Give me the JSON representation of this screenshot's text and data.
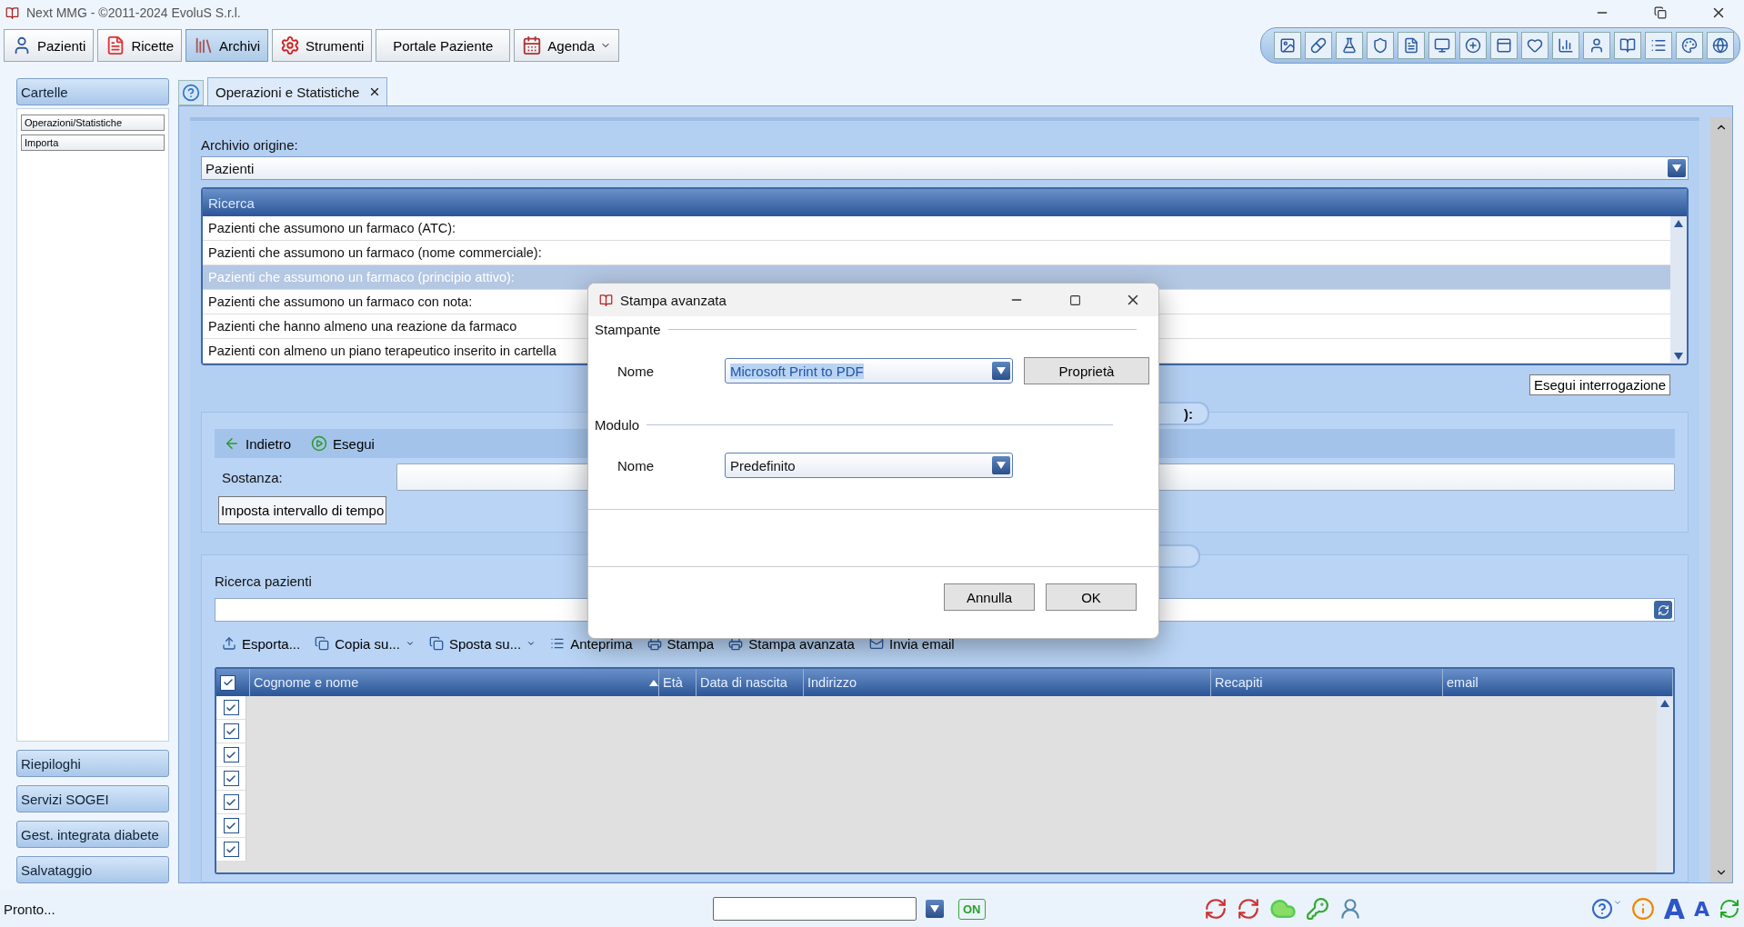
{
  "window": {
    "title": "Next MMG - ©2011-2024 EvoluS S.r.l."
  },
  "main_toolbar": [
    {
      "label": "Pazienti",
      "kind": "plain",
      "selected": false
    },
    {
      "label": "Ricette",
      "kind": "plain",
      "selected": false
    },
    {
      "label": "Archivi",
      "kind": "plain",
      "selected": true
    },
    {
      "label": "Strumenti",
      "kind": "plain",
      "selected": false
    },
    {
      "label": "Portale Paziente",
      "kind": "plain",
      "selected": false
    },
    {
      "label": "Agenda",
      "kind": "dropdown",
      "selected": false
    }
  ],
  "sidebar": {
    "open_section": {
      "title": "Cartelle",
      "items": [
        {
          "label": "Operazioni/Statistiche"
        },
        {
          "label": "Importa"
        }
      ]
    },
    "sections": [
      "Riepiloghi",
      "Servizi SOGEI",
      "Gest. integrata diabete",
      "Salvataggio"
    ]
  },
  "tab": {
    "label": "Operazioni e Statistiche"
  },
  "archive": {
    "label": "Archivio origine:",
    "value": "Pazienti"
  },
  "search_list": {
    "header": "Ricerca",
    "items": [
      {
        "label": "Pazienti che assumono un farmaco (ATC):",
        "selected": false
      },
      {
        "label": "Pazienti che assumono un farmaco (nome commerciale):",
        "selected": false
      },
      {
        "label": "Pazienti che assumono un farmaco (principio attivo):",
        "selected": true
      },
      {
        "label": "Pazienti che assumono un farmaco con nota:",
        "selected": false
      },
      {
        "label": "Pazienti che hanno almeno una reazione da farmaco",
        "selected": false
      },
      {
        "label": "Pazienti con almeno un piano terapeutico inserito in cartella",
        "selected": false
      }
    ]
  },
  "run_query_button": "Esegui interrogazione",
  "criteria": {
    "group_title": "):",
    "back": "Indietro",
    "run": "Esegui",
    "field_label": "Sostanza:",
    "time_button": "Imposta intervallo di tempo"
  },
  "patients": {
    "label": "Ricerca pazienti",
    "actions": [
      {
        "label": "Esporta...",
        "dropdown": false
      },
      {
        "label": "Copia su...",
        "dropdown": true
      },
      {
        "label": "Sposta su...",
        "dropdown": true
      },
      {
        "label": "Anteprima",
        "dropdown": false
      },
      {
        "label": "Stampa",
        "dropdown": false
      },
      {
        "label": "Stampa avanzata",
        "dropdown": false
      },
      {
        "label": "Invia email",
        "dropdown": false
      }
    ],
    "columns": [
      "Cognome e nome",
      "Età",
      "Data di nascita",
      "Indirizzo",
      "Recapiti",
      "email"
    ],
    "header_checked": true,
    "rows": [
      {
        "checked": true
      },
      {
        "checked": true
      },
      {
        "checked": true
      },
      {
        "checked": true
      },
      {
        "checked": true
      },
      {
        "checked": true
      },
      {
        "checked": true
      }
    ]
  },
  "status_bar": {
    "text": "Pronto...",
    "online": "ON",
    "font_buttons": [
      "A",
      "A"
    ]
  },
  "dialog": {
    "title": "Stampa avanzata",
    "printer": {
      "section": "Stampante",
      "label": "Nome",
      "value": "Microsoft Print to PDF",
      "button": "Proprietà"
    },
    "form": {
      "section": "Modulo",
      "label": "Nome",
      "value": "Predefinito"
    },
    "buttons": [
      "Annulla",
      "OK"
    ]
  }
}
